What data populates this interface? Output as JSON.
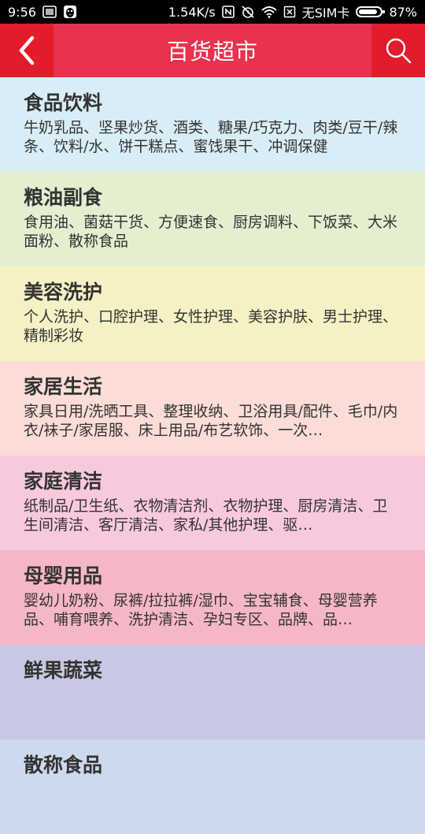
{
  "status_bar": {
    "time": "9:56",
    "speed": "1.54K/s",
    "sim": "无SIM卡",
    "battery_text": "87%",
    "battery_level": 0.87
  },
  "header": {
    "title": "百货超市"
  },
  "colors": {
    "appbar": "#e8324e",
    "appbar_button": "#e21c2b"
  },
  "categories": [
    {
      "name": "食品饮料",
      "desc": "牛奶乳品、坚果炒货、酒类、糖果/巧克力、肉类/豆干/辣条、饮料/水、饼干糕点、蜜饯果干、冲调保健",
      "color": "#d9edf7"
    },
    {
      "name": "粮油副食",
      "desc": "食用油、菌菇干货、方便速食、厨房调料、下饭菜、大米面粉、散称食品",
      "color": "#e3efcf"
    },
    {
      "name": "美容洗护",
      "desc": "个人洗护、口腔护理、女性护理、美容护肤、男士护理、精制彩妆",
      "color": "#f5f1c4"
    },
    {
      "name": "家居生活",
      "desc": "家具日用/洗晒工具、整理收纳、卫浴用具/配件、毛巾/内衣/袜子/家居服、床上用品/布艺软饰、一次…",
      "color": "#fbdcd6"
    },
    {
      "name": "家庭清洁",
      "desc": "纸制品/卫生纸、衣物清洁剂、衣物护理、厨房清洁、卫生间清洁、客厅清洁、家私/其他护理、驱…",
      "color": "#f8c9dc"
    },
    {
      "name": "母婴用品",
      "desc": "婴幼儿奶粉、尿裤/拉拉裤/湿巾、宝宝辅食、母婴营养品、哺育喂养、洗护清洁、孕妇专区、品牌、品…",
      "color": "#f5b7c6"
    },
    {
      "name": "鲜果蔬菜",
      "desc": "",
      "color": "#c9c8e4"
    },
    {
      "name": "散称食品",
      "desc": "",
      "color": "#cdd9ec"
    }
  ]
}
